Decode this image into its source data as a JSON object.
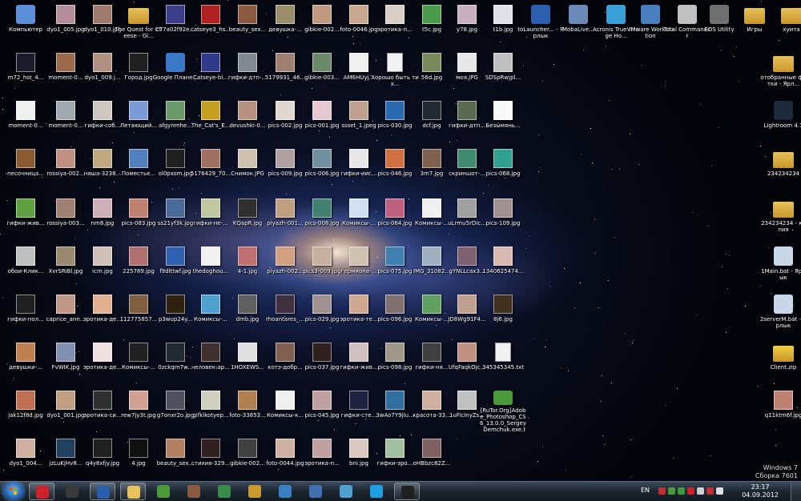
{
  "desktop": {
    "icons": [
      {
        "label": "Компьютер",
        "kind": "app",
        "color": "#5b8fd6"
      },
      {
        "label": "dyo1_005.jpg",
        "kind": "photo",
        "color": "#b48c9a"
      },
      {
        "label": "dyo1_010.jpg",
        "kind": "photo",
        "color": "#a07a6a"
      },
      {
        "label": "The Quest for Cheese - Gl...",
        "kind": "folder",
        "color": "#e8c25a"
      },
      {
        "label": "c77a02f92e...",
        "kind": "photo",
        "color": "#3a3d8a"
      },
      {
        "label": "catseye3_hs...",
        "kind": "photo",
        "color": "#b02020"
      },
      {
        "label": "beauty_sex...",
        "kind": "photo",
        "color": "#8a5a40"
      },
      {
        "label": "девушка-...",
        "kind": "photo",
        "color": "#9a8f6a"
      },
      {
        "label": "gibkie-002...",
        "kind": "photo",
        "color": "#c09a80"
      },
      {
        "label": "foto-0046.jpg",
        "kind": "photo",
        "color": "#caa890"
      },
      {
        "label": "эротика-п...",
        "kind": "photo",
        "color": "#d8d0c8"
      },
      {
        "label": "t5c.jpg",
        "kind": "photo",
        "color": "#4a9a4a"
      },
      {
        "label": "y78.jpg",
        "kind": "photo",
        "color": "#c8b0c0"
      },
      {
        "label": "t1b.jpg",
        "kind": "photo",
        "color": "#e0e0e8"
      },
      {
        "label": "toLauncher... - Ярлык",
        "kind": "app",
        "color": "#2a5fb0"
      },
      {
        "label": "MobaLive...",
        "kind": "app",
        "color": "#6a8ab8"
      },
      {
        "label": "Acronis True Image Ho...",
        "kind": "app",
        "color": "#3aa0d8"
      },
      {
        "label": "VMware Workstation",
        "kind": "app",
        "color": "#4a80c0"
      },
      {
        "label": "Total Commander",
        "kind": "app",
        "color": "#c0c0c0"
      },
      {
        "label": "EOS Utility",
        "kind": "app",
        "color": "#707070"
      },
      {
        "label": "Игры",
        "kind": "folder",
        "color": "#e8c25a"
      },
      {
        "label": "хуита",
        "kind": "folder",
        "color": "#e8c25a"
      },
      {
        "label": "m72_hst_4...",
        "kind": "photo",
        "color": "#1a1a2a"
      },
      {
        "label": "moment-0...",
        "kind": "photo",
        "color": "#9a6a4a"
      },
      {
        "label": "dyo1_009.j...",
        "kind": "photo",
        "color": "#b09080"
      },
      {
        "label": "Город.jpg",
        "kind": "photo",
        "color": "#202020"
      },
      {
        "label": "Google Плане...",
        "kind": "app",
        "color": "#3a78c8"
      },
      {
        "label": "Catseye-bi...",
        "kind": "photo",
        "color": "#303a8a"
      },
      {
        "label": "гифки-дтп-...",
        "kind": "photo",
        "color": "#808a90"
      },
      {
        "label": "5179931_46...",
        "kind": "photo",
        "color": "#a08070"
      },
      {
        "label": "gibkie-003...",
        "kind": "photo",
        "color": "#6a8a6a"
      },
      {
        "label": "AM6HUyj...",
        "kind": "photo",
        "color": "#f0f0f0"
      },
      {
        "label": "Хорошо быть тих...",
        "kind": "doc",
        "color": "#f2f2f2"
      },
      {
        "label": "56d.jpg",
        "kind": "photo",
        "color": "#7a8a5a"
      },
      {
        "label": "моя.JPG",
        "kind": "photo",
        "color": "#e8e8e8"
      },
      {
        "label": "SDSpRwjpl...",
        "kind": "photo",
        "color": "#c0c0c0"
      },
      {
        "label": "отобранные фотки - Ярл...",
        "kind": "folder",
        "color": "#e8c25a"
      },
      {
        "label": "moment-0...",
        "kind": "photo",
        "color": "#f0f0f0"
      },
      {
        "label": "moment-0...",
        "kind": "photo",
        "color": "#a0a8b0"
      },
      {
        "label": "гифки-соб...",
        "kind": "photo",
        "color": "#d0c8c0"
      },
      {
        "label": "Летающий...",
        "kind": "photo",
        "color": "#7a9ad8"
      },
      {
        "label": "afgynmhe...",
        "kind": "photo",
        "color": "#6a9a6a"
      },
      {
        "label": "The_Cat's_E...",
        "kind": "photo",
        "color": "#c8a020"
      },
      {
        "label": "devushki-0...",
        "kind": "photo",
        "color": "#b89080"
      },
      {
        "label": "pics-002.jpg",
        "kind": "photo",
        "color": "#e0d8d0"
      },
      {
        "label": "pics-001.jpg",
        "kind": "photo",
        "color": "#e8c8d0"
      },
      {
        "label": "ssset_1.jpeg",
        "kind": "photo",
        "color": "#c0a090"
      },
      {
        "label": "pics-030.jpg",
        "kind": "photo",
        "color": "#2a6ab0"
      },
      {
        "label": "dcf.jpg",
        "kind": "photo",
        "color": "#202830"
      },
      {
        "label": "гифки-дтп...",
        "kind": "photo",
        "color": "#5a6a50"
      },
      {
        "label": "Безымянь...",
        "kind": "photo",
        "color": "#f8f8f8"
      },
      {
        "label": "Lightroom 4.1",
        "kind": "app",
        "color": "#1a2a3a"
      },
      {
        "label": "песочница...",
        "kind": "photo",
        "color": "#8a5a30"
      },
      {
        "label": "rossiya-002...",
        "kind": "photo",
        "color": "#c09080"
      },
      {
        "label": "няша-3238...",
        "kind": "photo",
        "color": "#c0a880"
      },
      {
        "label": "Поместье...",
        "kind": "photo",
        "color": "#5080c0"
      },
      {
        "label": "ol0pxsm.jpg",
        "kind": "photo",
        "color": "#202020"
      },
      {
        "label": "5176429_70...",
        "kind": "photo",
        "color": "#a07060"
      },
      {
        "label": "Снимок.JPG",
        "kind": "photo",
        "color": "#d0c0b0"
      },
      {
        "label": "pics-009.jpg",
        "kind": "photo",
        "color": "#b0a0a0"
      },
      {
        "label": "pics-006.jpg",
        "kind": "photo",
        "color": "#7090a0"
      },
      {
        "label": "гифки-иис...",
        "kind": "photo",
        "color": "#e8e8e8"
      },
      {
        "label": "pics-046.jpg",
        "kind": "photo",
        "color": "#d07040"
      },
      {
        "label": "3m7.jpg",
        "kind": "photo",
        "color": "#806050"
      },
      {
        "label": "скриншот-...",
        "kind": "photo",
        "color": "#408a70"
      },
      {
        "label": "pics-068.jpg",
        "kind": "photo",
        "color": "#30a090"
      },
      {
        "label": "234234234",
        "kind": "folder",
        "color": "#e8c25a"
      },
      {
        "label": "гифки-жив...",
        "kind": "photo",
        "color": "#60a040"
      },
      {
        "label": "rossiya-003...",
        "kind": "photo",
        "color": "#a08070"
      },
      {
        "label": "nm8.jpg",
        "kind": "photo",
        "color": "#d0b0b8"
      },
      {
        "label": "pics-083.jpg",
        "kind": "photo",
        "color": "#c08070"
      },
      {
        "label": "ss21yf3k.jpg",
        "kind": "photo",
        "color": "#4a6a9a"
      },
      {
        "label": "гифки-не-...",
        "kind": "photo",
        "color": "#c0c8a0"
      },
      {
        "label": "KQapR.jpg",
        "kind": "photo",
        "color": "#303030"
      },
      {
        "label": "plyazh-001...",
        "kind": "photo",
        "color": "#c0a080"
      },
      {
        "label": "pics-008.jpg",
        "kind": "photo",
        "color": "#408070"
      },
      {
        "label": "Комиксы-...",
        "kind": "photo",
        "color": "#d0e0f0"
      },
      {
        "label": "pics-064.jpg",
        "kind": "photo",
        "color": "#c06080"
      },
      {
        "label": "Комиксы-...",
        "kind": "photo",
        "color": "#f0f0f0"
      },
      {
        "label": "uLrmu5rDic...",
        "kind": "photo",
        "color": "#a0a0a0"
      },
      {
        "label": "pics-109.jpg",
        "kind": "photo",
        "color": "#a09090"
      },
      {
        "label": "234234234 - копия",
        "kind": "folder",
        "color": "#e8c25a"
      },
      {
        "label": "обои-Клик...",
        "kind": "photo",
        "color": "#c0c0c0"
      },
      {
        "label": "XvrSRiBl.jpg",
        "kind": "photo",
        "color": "#9a8a70"
      },
      {
        "label": "icm.jpg",
        "kind": "photo",
        "color": "#d0c0b8"
      },
      {
        "label": "225789.jpg",
        "kind": "photo",
        "color": "#b07070"
      },
      {
        "label": "f9dlttwf.jpg",
        "kind": "photo",
        "color": "#3060b0"
      },
      {
        "label": "thedoghou...",
        "kind": "photo",
        "color": "#f0f0f0"
      },
      {
        "label": "4-1.jpg",
        "kind": "photo",
        "color": "#c07070"
      },
      {
        "label": "plyazh-002...",
        "kind": "photo",
        "color": "#d0a080"
      },
      {
        "label": "pics3-009.jpg",
        "kind": "photo",
        "color": "#c8b0a0"
      },
      {
        "label": "гермиона-...",
        "kind": "photo",
        "color": "#d0c0b0"
      },
      {
        "label": "pics-075.jpg",
        "kind": "photo",
        "color": "#4080b0"
      },
      {
        "label": "IMG_31082...",
        "kind": "photo",
        "color": "#a0b0c0"
      },
      {
        "label": "gYNLLcax3...",
        "kind": "photo",
        "color": "#806070"
      },
      {
        "label": "1340625474...",
        "kind": "photo",
        "color": "#d8b8b0"
      },
      {
        "label": "1Main.bat - Ярлык",
        "kind": "app",
        "color": "#c8d8e8"
      },
      {
        "label": "гифки-пол...",
        "kind": "photo",
        "color": "#202020"
      },
      {
        "label": "caprice_ann...",
        "kind": "photo",
        "color": "#c09888"
      },
      {
        "label": "эротика-де...",
        "kind": "photo",
        "color": "#e0b090"
      },
      {
        "label": "112775857...",
        "kind": "photo",
        "color": "#806040"
      },
      {
        "label": "p3wup24y...",
        "kind": "photo",
        "color": "#302010"
      },
      {
        "label": "Комиксы-...",
        "kind": "photo",
        "color": "#50a0d0"
      },
      {
        "label": "dmb.jpg",
        "kind": "photo",
        "color": "#606060"
      },
      {
        "label": "rhoantares_...",
        "kind": "photo",
        "color": "#403040"
      },
      {
        "label": "pics-029.jpg",
        "kind": "photo",
        "color": "#a09090"
      },
      {
        "label": "эротика-те...",
        "kind": "photo",
        "color": "#d0a890"
      },
      {
        "label": "pics-096.jpg",
        "kind": "photo",
        "color": "#807070"
      },
      {
        "label": "Комиксы-...",
        "kind": "photo",
        "color": "#60a060"
      },
      {
        "label": "JD8Wg91F4...",
        "kind": "photo",
        "color": "#c0a090"
      },
      {
        "label": "8j6.jpg",
        "kind": "photo",
        "color": "#403020"
      },
      {
        "label": "2serverM.bat - Ярлык",
        "kind": "app",
        "color": "#c8d8e8"
      },
      {
        "label": "девушки-...",
        "kind": "photo",
        "color": "#c08050"
      },
      {
        "label": "FvWIK.jpg",
        "kind": "photo",
        "color": "#8090b0"
      },
      {
        "label": "эротика-де...",
        "kind": "photo",
        "color": "#f0e0e0"
      },
      {
        "label": "Комиксы-...",
        "kind": "photo",
        "color": "#202020"
      },
      {
        "label": "0zckqm7w...",
        "kind": "photo",
        "color": "#202830"
      },
      {
        "label": "человек-ар...",
        "kind": "photo",
        "color": "#403030"
      },
      {
        "label": "1HOXEWS...",
        "kind": "photo",
        "color": "#e0e0e0"
      },
      {
        "label": "котэ-добр...",
        "kind": "photo",
        "color": "#806050"
      },
      {
        "label": "pics-037.jpg",
        "kind": "photo",
        "color": "#302020"
      },
      {
        "label": "гифки-жив...",
        "kind": "photo",
        "color": "#d0c0c0"
      },
      {
        "label": "pics-098.jpg",
        "kind": "photo",
        "color": "#a09888"
      },
      {
        "label": "гифки-ня...",
        "kind": "photo",
        "color": "#404040"
      },
      {
        "label": "UfqFaqkOjc...",
        "kind": "photo",
        "color": "#c09080"
      },
      {
        "label": "345345345.txt",
        "kind": "doc",
        "color": "#f2f2f2"
      },
      {
        "label": "Client.zip",
        "kind": "folder",
        "color": "#f0d040"
      },
      {
        "label": "jak12f8d.jpg",
        "kind": "photo",
        "color": "#c07050"
      },
      {
        "label": "dyo1_001.jpg",
        "kind": "photo",
        "color": "#c0a080"
      },
      {
        "label": "эротика-си...",
        "kind": "photo",
        "color": "#303030"
      },
      {
        "label": "rew7jy3t.jpg",
        "kind": "photo",
        "color": "#d0a090"
      },
      {
        "label": "g7onxr2o.jpg",
        "kind": "photo",
        "color": "#505060"
      },
      {
        "label": "gifkikotyep...",
        "kind": "photo",
        "color": "#d0d0c0"
      },
      {
        "label": "foto-33853...",
        "kind": "photo",
        "color": "#b08050"
      },
      {
        "label": "Комиксы-к...",
        "kind": "photo",
        "color": "#f0f0f0"
      },
      {
        "label": "pics-045.jpg",
        "kind": "photo",
        "color": "#c0a0a0"
      },
      {
        "label": "гифки-сте...",
        "kind": "photo",
        "color": "#202040"
      },
      {
        "label": "3wAo7Y9jIu...",
        "kind": "photo",
        "color": "#3070a0"
      },
      {
        "label": "красота-33...",
        "kind": "photo",
        "color": "#d0b0a0"
      },
      {
        "label": "1uFicInyZs...",
        "kind": "photo",
        "color": "#c0c0c0"
      },
      {
        "label": "[RuTor.Org]Adobe_Photoshop_CS6_13.0.0_Sergey_Demchuk.exe.torrent",
        "kind": "app",
        "color": "#4a9a3a"
      },
      {
        "label": "q11ktm6f.jpg",
        "kind": "photo",
        "color": "#c08070"
      },
      {
        "label": "dyo1_004...",
        "kind": "photo",
        "color": "#d0b0a0"
      },
      {
        "label": "jzLuKjHv8...",
        "kind": "photo",
        "color": "#204060"
      },
      {
        "label": "q4y8xfjy.jpg",
        "kind": "photo",
        "color": "#202020"
      },
      {
        "label": "4.jpg",
        "kind": "photo",
        "color": "#101010"
      },
      {
        "label": "beauty_sex...",
        "kind": "photo",
        "color": "#b08060"
      },
      {
        "label": "стихия-329...",
        "kind": "photo",
        "color": "#302020"
      },
      {
        "label": "gibkie-002...",
        "kind": "photo",
        "color": "#404040"
      },
      {
        "label": "foto-0044.jpg",
        "kind": "photo",
        "color": "#d0b0a0"
      },
      {
        "label": "эротика-п...",
        "kind": "photo",
        "color": "#c0a0a0"
      },
      {
        "label": "bni.jpg",
        "kind": "photo",
        "color": "#d8c8c0"
      },
      {
        "label": "гифки-эро...",
        "kind": "photo",
        "color": "#a0c0a0"
      },
      {
        "label": "oHBbzc82Z...",
        "kind": "photo",
        "color": "#806060"
      }
    ]
  },
  "watermark": {
    "line1": "Windows 7",
    "line2": "Сборка 7601"
  },
  "taskbar": {
    "buttons": [
      {
        "name": "opera-browser",
        "color": "#d0202a",
        "active": true
      },
      {
        "name": "media-player",
        "color": "#3a3a3a",
        "active": false
      },
      {
        "name": "tolauncher",
        "color": "#2a5fb0",
        "active": true
      },
      {
        "name": "file-explorer",
        "color": "#e8c25a",
        "active": true
      },
      {
        "name": "utorrent",
        "color": "#4a9a3a",
        "active": false
      },
      {
        "name": "photo-viewer",
        "color": "#8a5a40",
        "active": false
      },
      {
        "name": "network-tool",
        "color": "#3a8a4a",
        "active": false
      },
      {
        "name": "excel-chart",
        "color": "#c89a30",
        "active": false
      },
      {
        "name": "download-manager",
        "color": "#3a80c0",
        "active": false
      },
      {
        "name": "printer",
        "color": "#4070b0",
        "active": false
      },
      {
        "name": "notepad",
        "color": "#50a0d0",
        "active": false
      },
      {
        "name": "skype",
        "color": "#1ea0e0",
        "active": false
      },
      {
        "name": "console",
        "color": "#202020",
        "active": true
      }
    ],
    "tray": {
      "lang": "EN",
      "time": "23:17",
      "date": "04.09.2012",
      "icons": [
        {
          "name": "network-icon",
          "color": "#c03030"
        },
        {
          "name": "utorrent-tray-icon",
          "color": "#4a9a3a"
        },
        {
          "name": "security-icon",
          "color": "#3a9a3a"
        },
        {
          "name": "opera-tray-icon",
          "color": "#d0202a"
        },
        {
          "name": "flag-icon",
          "color": "#d0d0d0"
        },
        {
          "name": "alert-icon",
          "color": "#c03030"
        },
        {
          "name": "volume-icon",
          "color": "#e0e0e0"
        }
      ]
    }
  }
}
